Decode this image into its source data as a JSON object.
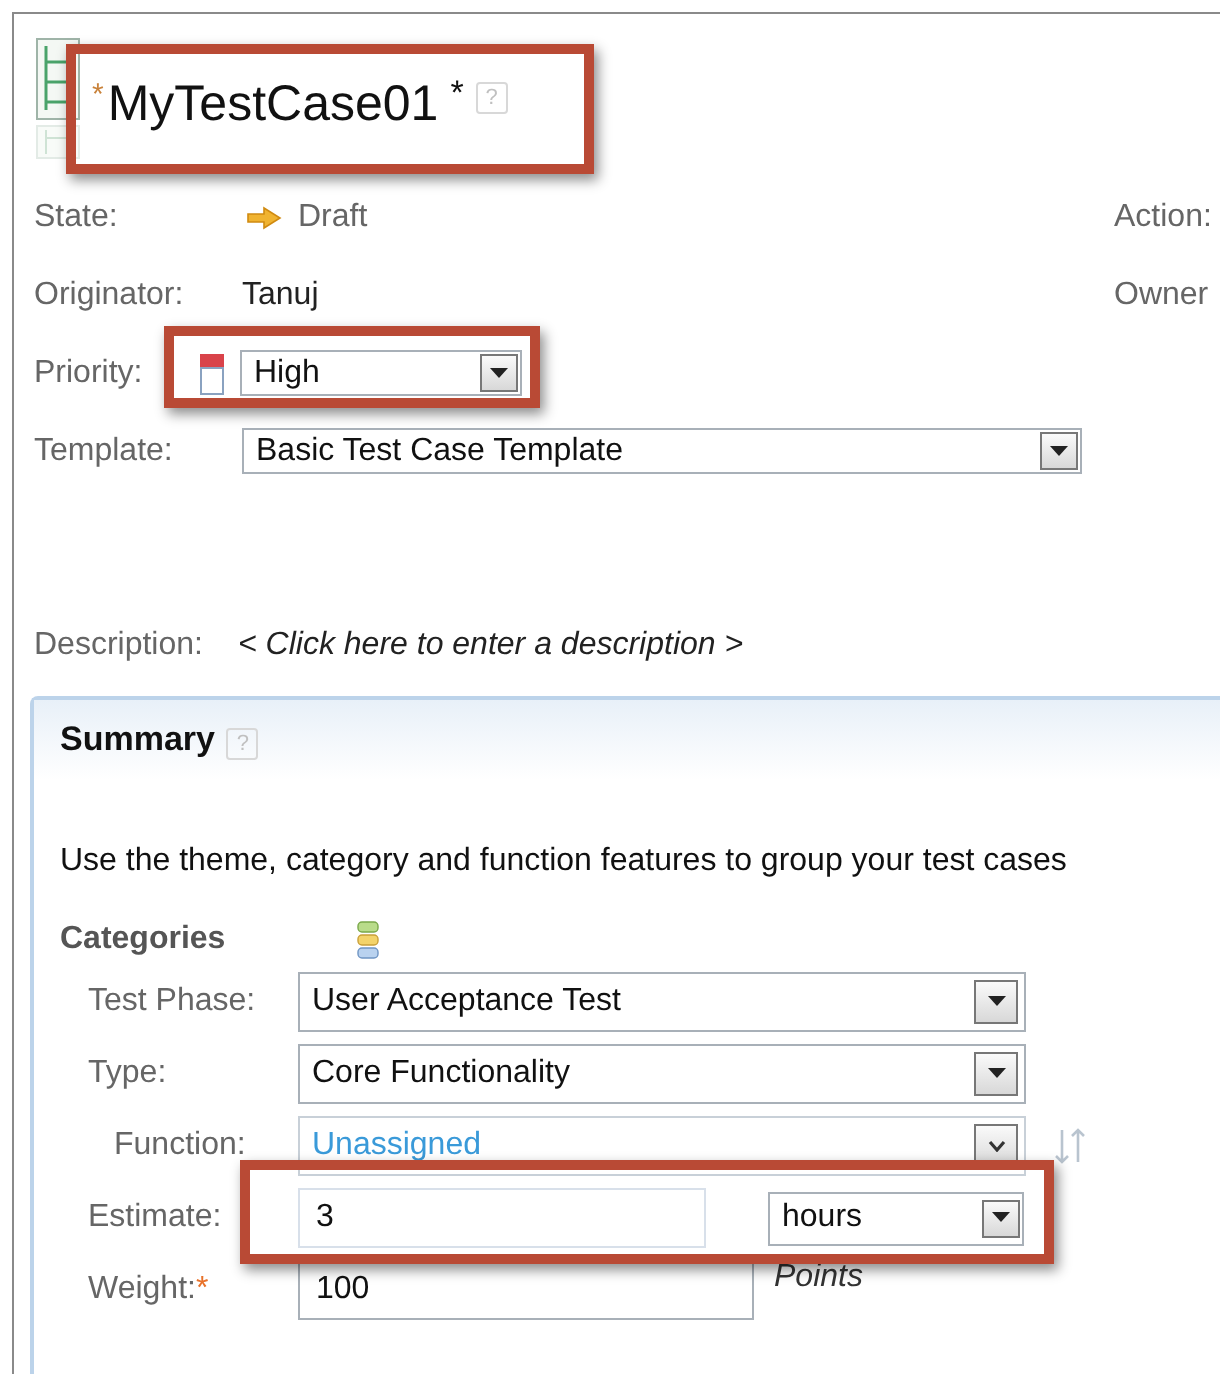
{
  "title": {
    "required_mark": "*",
    "text": "MyTestCase01",
    "dirty_mark": "*",
    "help_mark": "?",
    "highlighted": true
  },
  "fields": [
    {
      "kind": "state",
      "label": "State:",
      "value": "Draft"
    },
    {
      "kind": "text",
      "label": "Originator:",
      "value": "Tanuj"
    },
    {
      "kind": "priority",
      "label": "Priority:",
      "value": "High",
      "highlighted": true
    },
    {
      "kind": "select",
      "label": "Template:",
      "value": "Basic Test Case Template"
    }
  ],
  "side_labels": [
    "Action:",
    "Owner"
  ],
  "description": {
    "label": "Description:",
    "placeholder": "< Click here to enter a description >"
  },
  "summary": {
    "title": "Summary",
    "help_mark": "?",
    "text": "Use the theme, category and function features to group your test cases",
    "categories_label": "Categories",
    "rows": [
      {
        "kind": "select",
        "label": "Test Phase:",
        "value": "User Acceptance Test"
      },
      {
        "kind": "select",
        "label": "Type:",
        "value": "Core Functionality"
      },
      {
        "kind": "link-select",
        "label": "Function:",
        "value": "Unassigned"
      },
      {
        "kind": "estimate",
        "label": "Estimate:",
        "value": "3",
        "unit": "hours",
        "highlighted": true
      },
      {
        "kind": "weight",
        "label": "Weight:",
        "required_mark": "*",
        "value": "100",
        "unit": "Points"
      }
    ]
  }
}
